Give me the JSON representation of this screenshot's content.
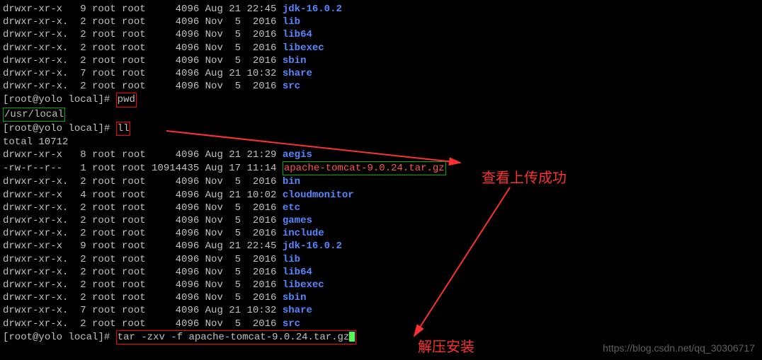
{
  "top_listing": [
    {
      "perm": "drwxr-xr-x",
      "links": "9",
      "owner": "root",
      "group": "root",
      "size": "4096",
      "date": "Aug 21 22:45",
      "name": "jdk-16.0.2",
      "isdir": true
    },
    {
      "perm": "drwxr-xr-x.",
      "links": "2",
      "owner": "root",
      "group": "root",
      "size": "4096",
      "date": "Nov  5  2016",
      "name": "lib",
      "isdir": true
    },
    {
      "perm": "drwxr-xr-x.",
      "links": "2",
      "owner": "root",
      "group": "root",
      "size": "4096",
      "date": "Nov  5  2016",
      "name": "lib64",
      "isdir": true
    },
    {
      "perm": "drwxr-xr-x.",
      "links": "2",
      "owner": "root",
      "group": "root",
      "size": "4096",
      "date": "Nov  5  2016",
      "name": "libexec",
      "isdir": true
    },
    {
      "perm": "drwxr-xr-x.",
      "links": "2",
      "owner": "root",
      "group": "root",
      "size": "4096",
      "date": "Nov  5  2016",
      "name": "sbin",
      "isdir": true
    },
    {
      "perm": "drwxr-xr-x.",
      "links": "7",
      "owner": "root",
      "group": "root",
      "size": "4096",
      "date": "Aug 21 10:32",
      "name": "share",
      "isdir": true
    },
    {
      "perm": "drwxr-xr-x.",
      "links": "2",
      "owner": "root",
      "group": "root",
      "size": "4096",
      "date": "Nov  5  2016",
      "name": "src",
      "isdir": true
    }
  ],
  "prompt": {
    "open": "[",
    "user": "root",
    "at": "@",
    "host": "yolo",
    "sp": " ",
    "path": "local",
    "close": "]#"
  },
  "cmd1": "pwd",
  "pwd_output": "/usr/local",
  "cmd2": "ll",
  "total_line": "total 10712",
  "main_listing": [
    {
      "perm": "drwxr-xr-x",
      "links": "8",
      "owner": "root",
      "group": "root",
      "size": "4096",
      "date": "Aug 21 21:29",
      "name": "aegis",
      "isdir": true,
      "highlight": false
    },
    {
      "perm": "-rw-r--r--",
      "links": "1",
      "owner": "root",
      "group": "root",
      "size": "10914435",
      "date": "Aug 17 11:14",
      "name": "apache-tomcat-9.0.24.tar.gz",
      "isdir": false,
      "highlight": true
    },
    {
      "perm": "drwxr-xr-x.",
      "links": "2",
      "owner": "root",
      "group": "root",
      "size": "4096",
      "date": "Nov  5  2016",
      "name": "bin",
      "isdir": true,
      "highlight": false
    },
    {
      "perm": "drwxr-xr-x",
      "links": "4",
      "owner": "root",
      "group": "root",
      "size": "4096",
      "date": "Aug 21 10:02",
      "name": "cloudmonitor",
      "isdir": true,
      "highlight": false
    },
    {
      "perm": "drwxr-xr-x.",
      "links": "2",
      "owner": "root",
      "group": "root",
      "size": "4096",
      "date": "Nov  5  2016",
      "name": "etc",
      "isdir": true,
      "highlight": false
    },
    {
      "perm": "drwxr-xr-x.",
      "links": "2",
      "owner": "root",
      "group": "root",
      "size": "4096",
      "date": "Nov  5  2016",
      "name": "games",
      "isdir": true,
      "highlight": false
    },
    {
      "perm": "drwxr-xr-x.",
      "links": "2",
      "owner": "root",
      "group": "root",
      "size": "4096",
      "date": "Nov  5  2016",
      "name": "include",
      "isdir": true,
      "highlight": false
    },
    {
      "perm": "drwxr-xr-x",
      "links": "9",
      "owner": "root",
      "group": "root",
      "size": "4096",
      "date": "Aug 21 22:45",
      "name": "jdk-16.0.2",
      "isdir": true,
      "highlight": false
    },
    {
      "perm": "drwxr-xr-x.",
      "links": "2",
      "owner": "root",
      "group": "root",
      "size": "4096",
      "date": "Nov  5  2016",
      "name": "lib",
      "isdir": true,
      "highlight": false
    },
    {
      "perm": "drwxr-xr-x.",
      "links": "2",
      "owner": "root",
      "group": "root",
      "size": "4096",
      "date": "Nov  5  2016",
      "name": "lib64",
      "isdir": true,
      "highlight": false
    },
    {
      "perm": "drwxr-xr-x.",
      "links": "2",
      "owner": "root",
      "group": "root",
      "size": "4096",
      "date": "Nov  5  2016",
      "name": "libexec",
      "isdir": true,
      "highlight": false
    },
    {
      "perm": "drwxr-xr-x.",
      "links": "2",
      "owner": "root",
      "group": "root",
      "size": "4096",
      "date": "Nov  5  2016",
      "name": "sbin",
      "isdir": true,
      "highlight": false
    },
    {
      "perm": "drwxr-xr-x.",
      "links": "7",
      "owner": "root",
      "group": "root",
      "size": "4096",
      "date": "Aug 21 10:32",
      "name": "share",
      "isdir": true,
      "highlight": false
    },
    {
      "perm": "drwxr-xr-x.",
      "links": "2",
      "owner": "root",
      "group": "root",
      "size": "4096",
      "date": "Nov  5  2016",
      "name": "src",
      "isdir": true,
      "highlight": false
    }
  ],
  "cmd3": "tar -zxv -f apache-tomcat-9.0.24.tar.gz",
  "annotations": {
    "upload_success": "查看上传成功",
    "extract_install": "解压安装"
  },
  "watermark": "https://blog.csdn.net/qq_30306717"
}
